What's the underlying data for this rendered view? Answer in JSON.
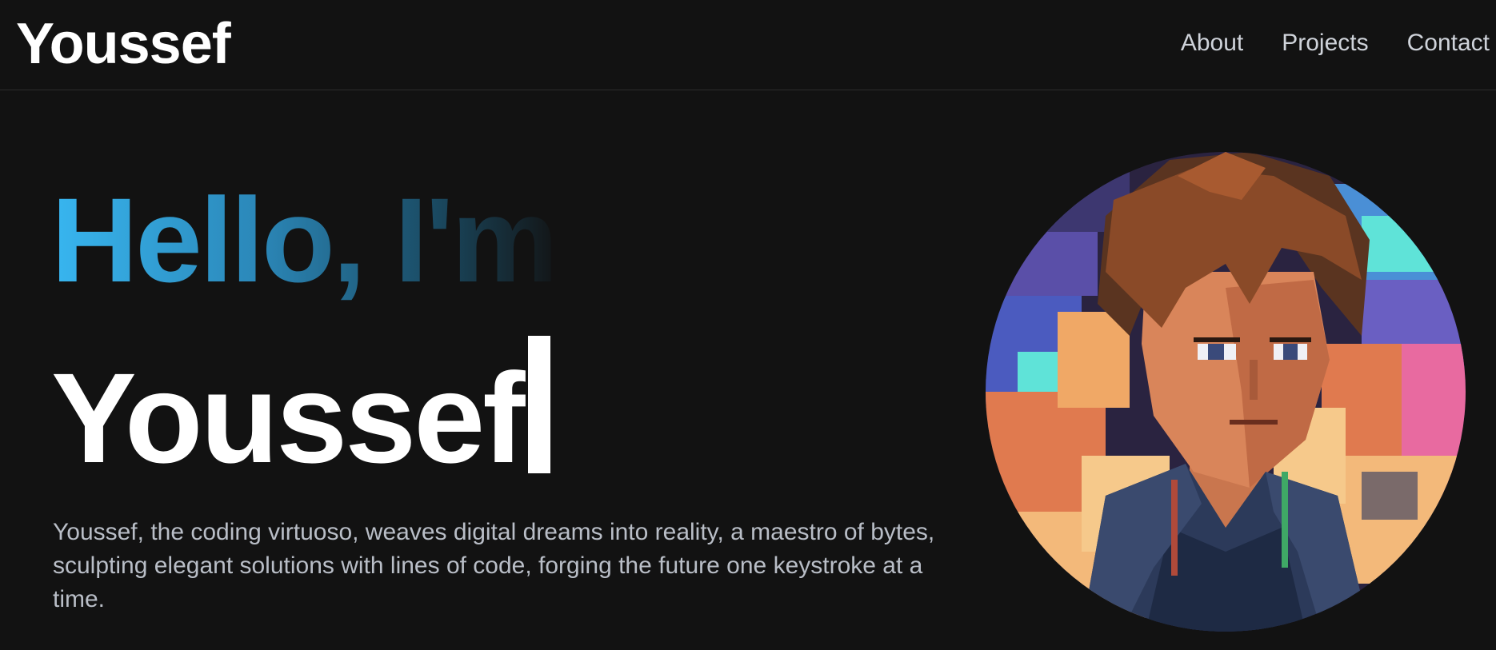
{
  "navbar": {
    "brand": "Youssef",
    "links": [
      {
        "label": "About"
      },
      {
        "label": "Projects"
      },
      {
        "label": "Contact"
      }
    ]
  },
  "hero": {
    "greeting": "Hello, I'm",
    "name": "Youssef",
    "bio": "Youssef, the coding virtuoso, weaves digital dreams into reality, a maestro of bytes, sculpting elegant solutions with lines of code, forging the future one keystroke at a time."
  },
  "colors": {
    "background": "#121212",
    "accent": "#38b6f0",
    "text": "#ffffff",
    "muted": "#b9bec7"
  }
}
